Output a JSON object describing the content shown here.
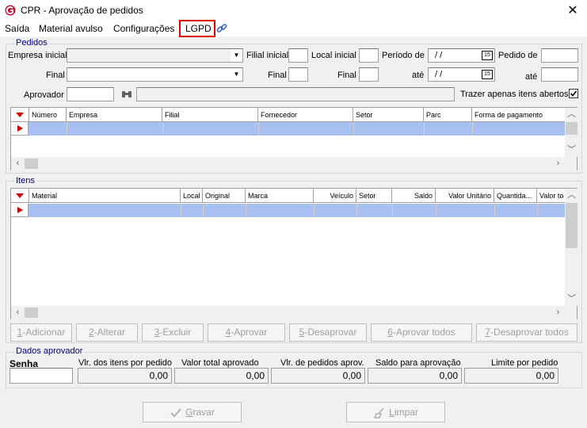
{
  "window": {
    "title": "CPR - Aprovação de pedidos",
    "close": "✕"
  },
  "menu": {
    "items": [
      "Saída",
      "Material avulso",
      "Configurações",
      "LGPD"
    ]
  },
  "pedidos": {
    "group_label": "Pedidos",
    "empresa_inicial_label": "Empresa inicial",
    "final_label": "Final",
    "filial_inicial_label": "Filial inicial",
    "filial_final_label": "Final",
    "local_inicial_label": "Local inicial",
    "local_final_label": "Final",
    "periodo_label": "Período de",
    "ate_label": "até",
    "date_from": "/ /",
    "date_to": "/ /",
    "pedido_de_label": "Pedido de",
    "pedido_ate_label": "até",
    "aprovador_label": "Aprovador",
    "trazer_label": "Trazer apenas itens abertos",
    "trazer_checked": true,
    "columns": [
      "Número",
      "Empresa",
      "Filial",
      "Fornecedor",
      "Setor",
      "Parc",
      "Forma de pagamento"
    ]
  },
  "itens": {
    "group_label": "Itens",
    "columns": [
      "Material",
      "Local",
      "Original",
      "Marca",
      "Veículo",
      "Setor",
      "Saldo",
      "Valor Unitário",
      "Quantida...",
      "Valor to"
    ]
  },
  "actions": [
    {
      "key": "1",
      "label": "-Adicionar"
    },
    {
      "key": "2",
      "label": "-Alterar"
    },
    {
      "key": "3",
      "label": "-Excluir"
    },
    {
      "key": "4",
      "label": "-Aprovar"
    },
    {
      "key": "5",
      "label": "-Desaprovar"
    },
    {
      "key": "6",
      "label": "-Aprovar todos"
    },
    {
      "key": "7",
      "label": "-Desaprovar todos"
    }
  ],
  "aprovador": {
    "group_label": "Dados aprovador",
    "senha_label": "Senha",
    "labels": [
      "Vlr. dos itens por pedido",
      "Valor total aprovado",
      "Vlr. de pedidos aprov.",
      "Saldo para aprovação",
      "Limite por pedido"
    ],
    "values": [
      "0,00",
      "0,00",
      "0,00",
      "0,00",
      "0,00"
    ]
  },
  "footer": {
    "gravar_key": "G",
    "gravar_rest": "ravar",
    "limpar_key": "L",
    "limpar_rest": "impar"
  },
  "colors": {
    "accent": "#a8c0f0",
    "highlight_border": "#e00000",
    "group_label": "#000080"
  }
}
